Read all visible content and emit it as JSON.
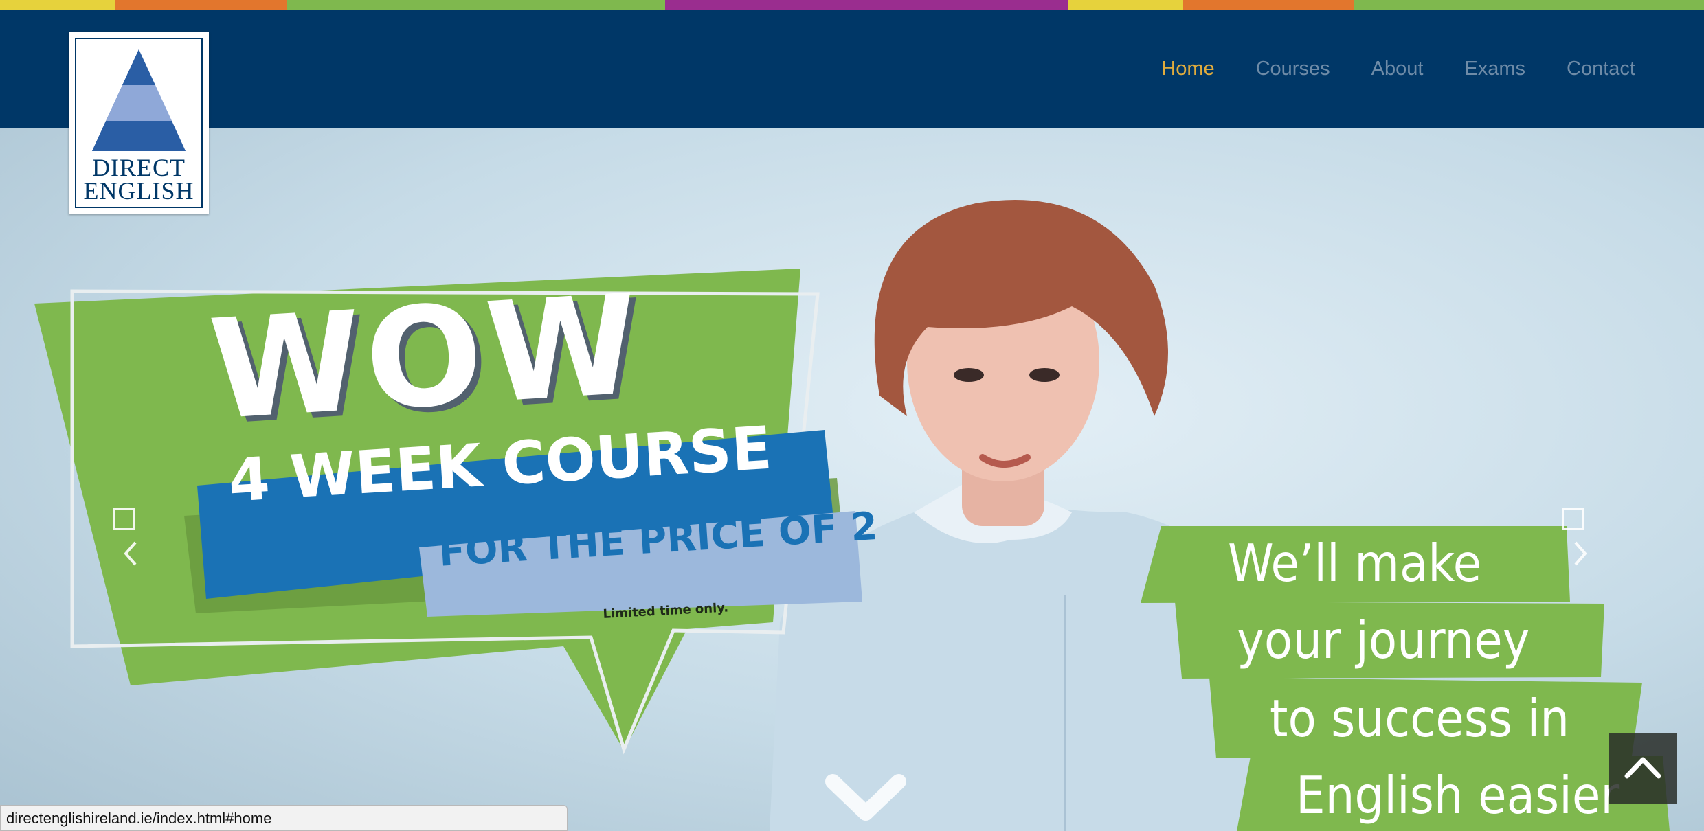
{
  "top_stripe_colors": [
    "#e6d23c",
    "#e2762d",
    "#7fb84e",
    "#9a2d8f",
    "#7fb84e",
    "#e6d23c",
    "#e2762d",
    "#7fb84e"
  ],
  "logo": {
    "line1": "DIRECT",
    "line2": "ENGLISH"
  },
  "nav": [
    {
      "label": "Home",
      "active": true
    },
    {
      "label": "Courses",
      "active": false
    },
    {
      "label": "About",
      "active": false
    },
    {
      "label": "Exams",
      "active": false
    },
    {
      "label": "Contact",
      "active": false
    }
  ],
  "promo": {
    "headline": "WOW",
    "line1": "4 WEEK COURSE",
    "line2": "FOR THE PRICE OF 2",
    "fine_print": "Limited time only."
  },
  "tagline": [
    "We’ll make",
    "your journey",
    "to success in",
    "English easier"
  ],
  "carousel": {
    "prev_icon": "chevron-left-icon",
    "next_icon": "chevron-right-icon",
    "scroll_icon": "chevron-down-icon"
  },
  "back_to_top_icon": "chevron-up-icon",
  "status_url": "directenglishireland.ie/index.html#home",
  "colors": {
    "navy": "#003767",
    "nav_active": "#e1ac3d",
    "nav_inactive": "#6e8ba7",
    "promo_green": "#7fb84e",
    "promo_blue": "#1a72b5",
    "promo_light_blue": "#9cb8dc"
  }
}
